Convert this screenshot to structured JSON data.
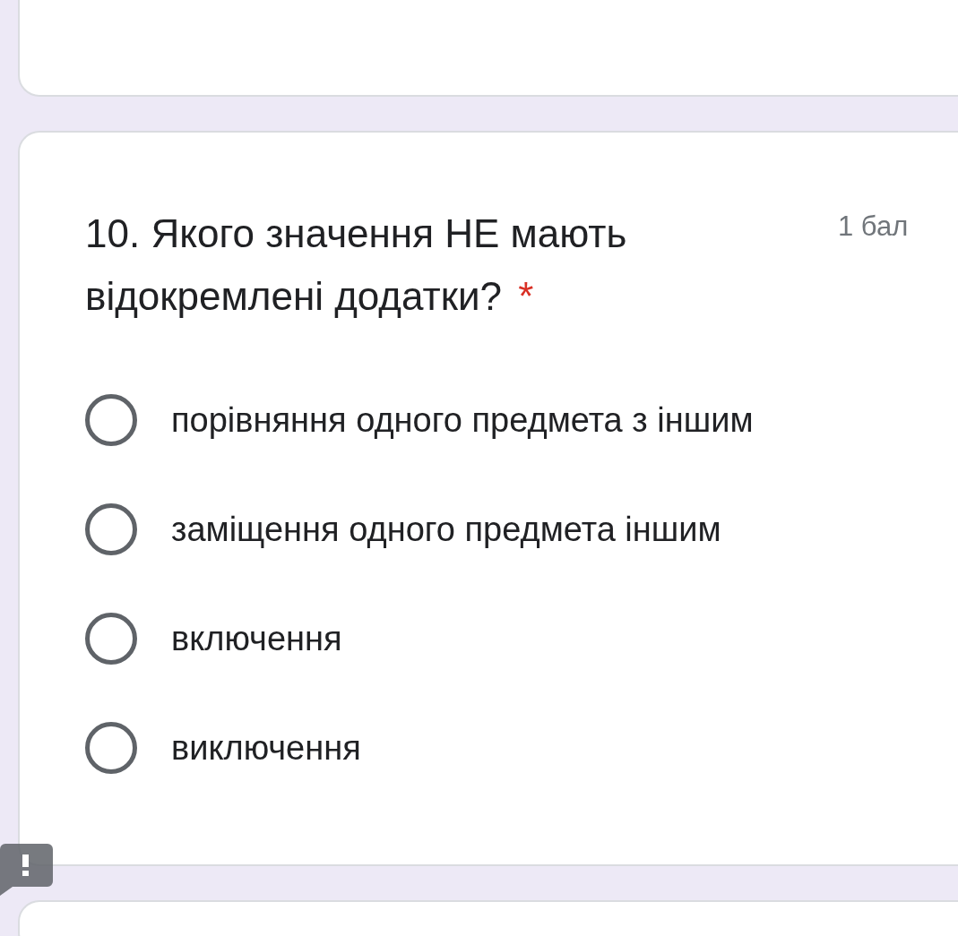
{
  "question": {
    "title": "10. Якого значення НЕ мають відокремлені додатки?",
    "required_mark": "*",
    "points": "1 бал",
    "options": [
      {
        "label": "порівняння одного предмета з іншим",
        "selected": false
      },
      {
        "label": "заміщення одного предмета іншим",
        "selected": false
      },
      {
        "label": "включення",
        "selected": false
      },
      {
        "label": "виключення",
        "selected": false
      }
    ]
  }
}
